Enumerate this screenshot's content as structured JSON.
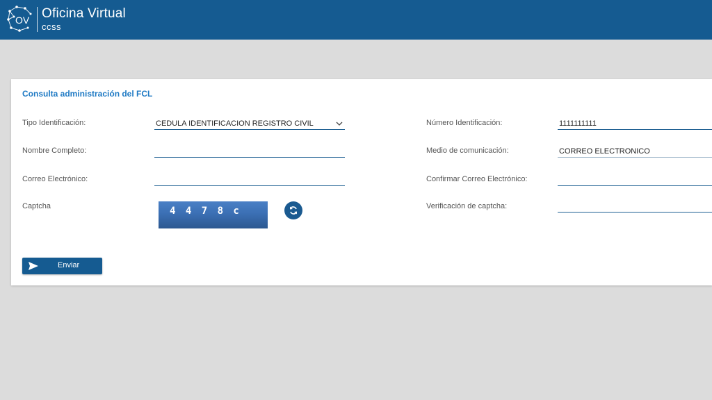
{
  "header": {
    "logo_text": "OV",
    "title": "Oficina Virtual",
    "subtitle": "ccss"
  },
  "form": {
    "title": "Consulta administración del FCL",
    "fields": {
      "tipo_identificacion": {
        "label": "Tipo Identificación:",
        "value": "CEDULA IDENTIFICACION REGISTRO CIVIL"
      },
      "numero_identificacion": {
        "label": "Número Identificación:",
        "value": "1111111111"
      },
      "nombre_completo": {
        "label": "Nombre Completo:",
        "value": ""
      },
      "medio_comunicacion": {
        "label": "Medio de comunicación:",
        "value": "CORREO ELECTRONICO"
      },
      "correo_electronico": {
        "label": "Correo Electrónico:",
        "value": ""
      },
      "confirmar_correo": {
        "label": "Confirmar Correo Electrónico:",
        "value": ""
      },
      "captcha": {
        "label": "Captcha",
        "image_text": "4 4 7 8 c"
      },
      "verificacion_captcha": {
        "label": "Verificación de captcha:",
        "value": ""
      }
    },
    "submit_label": "Enviar"
  },
  "icons": {
    "select_chevron": "chevron-down-icon",
    "captcha_refresh": "refresh-icon",
    "submit": "send-icon"
  },
  "colors": {
    "header_bg": "#155b91",
    "page_bg": "#dcdcdc",
    "title_color": "#1f7ac4",
    "button_bg": "#155b91"
  }
}
